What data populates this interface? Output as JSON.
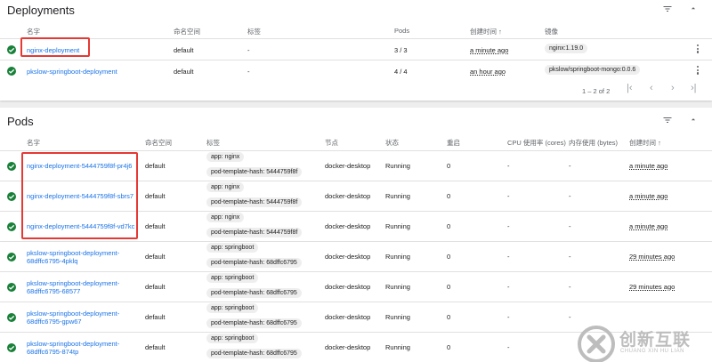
{
  "deployments": {
    "title": "Deployments",
    "headers": [
      "名字",
      "命名空间",
      "标签",
      "Pods",
      "创建时间",
      "镜像"
    ],
    "sort_arrow": "↑",
    "rows": [
      {
        "name": "nginx-deployment",
        "namespace": "default",
        "labels": "-",
        "pods": "3 / 3",
        "created": "a minute ago",
        "image": "nginx:1.19.0"
      },
      {
        "name": "pkslow-springboot-deployment",
        "namespace": "default",
        "labels": "-",
        "pods": "4 / 4",
        "created": "an hour ago",
        "image": "pkslow/springboot-mongo:0.0.6"
      }
    ],
    "pagination": "1 – 2 of 2"
  },
  "pods": {
    "title": "Pods",
    "headers": [
      "名字",
      "命名空间",
      "标签",
      "节点",
      "状态",
      "重启",
      "CPU 使用率 (cores)",
      "内存使用 (bytes)",
      "创建时间"
    ],
    "sort_arrow": "↑",
    "rows": [
      {
        "name": [
          "nginx-deployment-5444759f8f-pr4j6"
        ],
        "namespace": "default",
        "labels": [
          "app: nginx",
          "pod-template-hash: 5444759f8f"
        ],
        "node": "docker-desktop",
        "status": "Running",
        "restarts": "0",
        "cpu": "-",
        "mem": "-",
        "created": "a minute ago"
      },
      {
        "name": [
          "nginx-deployment-5444759f8f-sbrs7"
        ],
        "namespace": "default",
        "labels": [
          "app: nginx",
          "pod-template-hash: 5444759f8f"
        ],
        "node": "docker-desktop",
        "status": "Running",
        "restarts": "0",
        "cpu": "-",
        "mem": "-",
        "created": "a minute ago"
      },
      {
        "name": [
          "nginx-deployment-5444759f8f-vd7kc"
        ],
        "namespace": "default",
        "labels": [
          "app: nginx",
          "pod-template-hash: 5444759f8f"
        ],
        "node": "docker-desktop",
        "status": "Running",
        "restarts": "0",
        "cpu": "-",
        "mem": "-",
        "created": "a minute ago"
      },
      {
        "name": [
          "pkslow-springboot-deployment-",
          "68dffc6795-4pklq"
        ],
        "namespace": "default",
        "labels": [
          "app: springboot",
          "pod-template-hash: 68dffc6795"
        ],
        "node": "docker-desktop",
        "status": "Running",
        "restarts": "0",
        "cpu": "-",
        "mem": "-",
        "created": "29 minutes ago"
      },
      {
        "name": [
          "pkslow-springboot-deployment-",
          "68dffc6795-68577"
        ],
        "namespace": "default",
        "labels": [
          "app: springboot",
          "pod-template-hash: 68dffc6795"
        ],
        "node": "docker-desktop",
        "status": "Running",
        "restarts": "0",
        "cpu": "-",
        "mem": "-",
        "created": "29 minutes ago"
      },
      {
        "name": [
          "pkslow-springboot-deployment-",
          "68dffc6795-gpw67"
        ],
        "namespace": "default",
        "labels": [
          "app: springboot",
          "pod-template-hash: 68dffc6795"
        ],
        "node": "docker-desktop",
        "status": "Running",
        "restarts": "0",
        "cpu": "-",
        "mem": "-",
        "created": ""
      },
      {
        "name": [
          "pkslow-springboot-deployment-",
          "68dffc6795-874tp"
        ],
        "namespace": "default",
        "labels": [
          "app: springboot",
          "pod-template-hash: 68dffc6795"
        ],
        "node": "docker-desktop",
        "status": "Running",
        "restarts": "0",
        "cpu": "-",
        "mem": "",
        "created": ""
      }
    ]
  },
  "watermark": {
    "main": "创新互联",
    "sub": "CHUANG XIN HU LIAN"
  },
  "icons": {
    "status": "check-circle-icon",
    "filter": "filter-list-icon",
    "collapse": "expand-less-icon",
    "menu": "more-vert-icon"
  },
  "colors": {
    "link": "#1a73e8",
    "ok": "#188038",
    "highlight": "#e53935"
  }
}
